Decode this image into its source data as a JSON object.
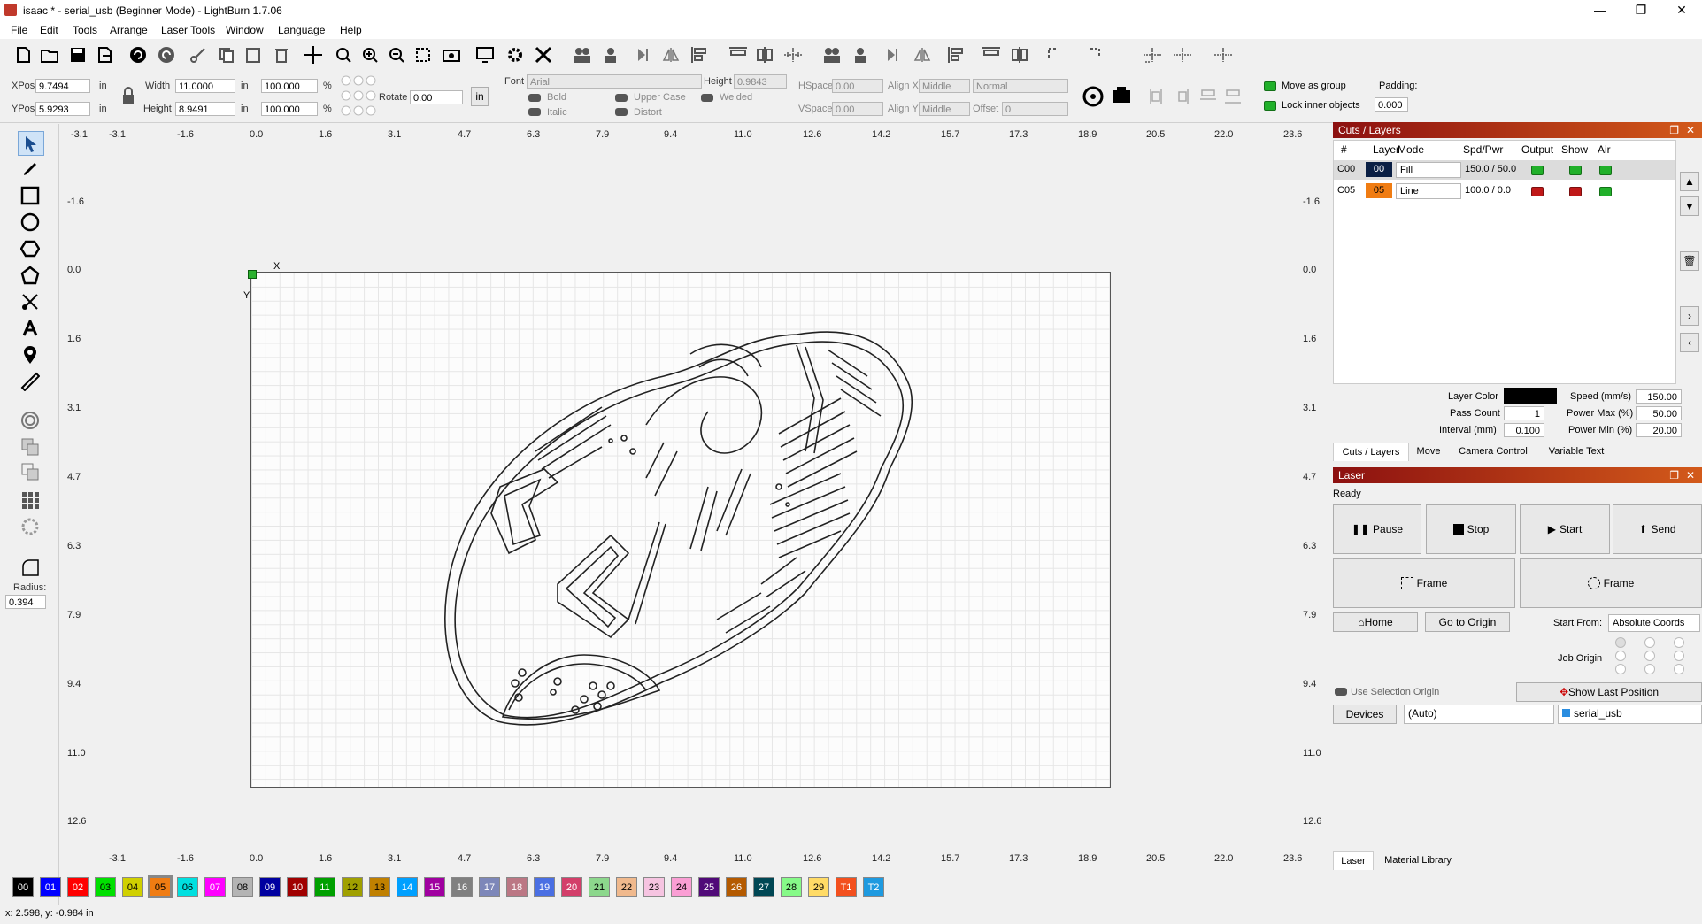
{
  "window": {
    "title": "isaac * - serial_usb (Beginner Mode) - LightBurn 1.7.06"
  },
  "menu": [
    "File",
    "Edit",
    "Tools",
    "Arrange",
    "Laser Tools",
    "Window",
    "Language",
    "Help"
  ],
  "toolbar2": {
    "xpos_label": "XPos",
    "xpos": "9.7494",
    "ypos_label": "YPos",
    "ypos": "5.9293",
    "unit": "in",
    "width_label": "Width",
    "width": "11.0000",
    "height_label": "Height",
    "height": "8.9491",
    "pct_w": "100.000",
    "pct_h": "100.000",
    "pct": "%",
    "rotate_label": "Rotate",
    "rotate": "0.00",
    "unit_btn": "in",
    "font_label": "Font",
    "font": "Arial",
    "fheight_label": "Height",
    "fheight": "0.9843",
    "bold": "Bold",
    "italic": "Italic",
    "upper": "Upper Case",
    "distort": "Distort",
    "welded": "Welded",
    "hspace_label": "HSpace",
    "hspace": "0.00",
    "vspace_label": "VSpace",
    "vspace": "0.00",
    "alignx_label": "Align X",
    "alignx": "Middle",
    "aligny_label": "Align Y",
    "aligny": "Middle",
    "normal": "Normal",
    "offset_label": "Offset",
    "offset": "0",
    "move_group": "Move as group",
    "lock_inner": "Lock inner objects",
    "padding_label": "Padding:",
    "padding": "0.000"
  },
  "left_tools": {
    "radius_label": "Radius:",
    "radius": "0.394"
  },
  "rulers": {
    "top": [
      "-3.1",
      "-3.1",
      "-1.6",
      "0.0",
      "1.6",
      "3.1",
      "4.7",
      "6.3",
      "7.9",
      "9.4",
      "11.0",
      "12.6",
      "14.2",
      "15.7",
      "17.3",
      "18.9",
      "20.5",
      "22.0",
      "23.6"
    ],
    "bottom": [
      "-3.1",
      "-1.6",
      "0.0",
      "1.6",
      "3.1",
      "4.7",
      "6.3",
      "7.9",
      "9.4",
      "11.0",
      "12.6",
      "14.2",
      "15.7",
      "17.3",
      "18.9",
      "20.5",
      "22.0",
      "23.6"
    ],
    "side": [
      "-1.6",
      "0.0",
      "1.6",
      "3.1",
      "4.7",
      "6.3",
      "7.9",
      "9.4",
      "11.0",
      "12.6"
    ],
    "axis_x": "X",
    "axis_y": "Y"
  },
  "cuts_panel": {
    "title": "Cuts / Layers",
    "headers": [
      "#",
      "Layer",
      "Mode",
      "Spd/Pwr",
      "Output",
      "Show",
      "Air"
    ],
    "rows": [
      {
        "num": "C00",
        "layer": "00",
        "color": "#0a1f44",
        "mode": "Fill",
        "spdpwr": "150.0 / 50.0",
        "output": "on",
        "show": "on",
        "air": "on"
      },
      {
        "num": "C05",
        "layer": "05",
        "color": "#f07c12",
        "mode": "Line",
        "spdpwr": "100.0 / 0.0",
        "output": "off",
        "show": "off",
        "air": "on"
      }
    ],
    "layer_color_label": "Layer Color",
    "speed_label": "Speed (mm/s)",
    "speed": "150.00",
    "pass_label": "Pass Count",
    "pass": "1",
    "pmax_label": "Power Max (%)",
    "pmax": "50.00",
    "interval_label": "Interval (mm)",
    "interval": "0.100",
    "pmin_label": "Power Min (%)",
    "pmin": "20.00",
    "tabs": [
      "Cuts / Layers",
      "Move",
      "Camera Control",
      "Variable Text"
    ]
  },
  "laser_panel": {
    "title": "Laser",
    "status": "Ready",
    "pause": "Pause",
    "stop": "Stop",
    "start": "Start",
    "send": "Send",
    "frame1": "Frame",
    "frame2": "Frame",
    "home": "Home",
    "goto_origin": "Go to Origin",
    "start_from_label": "Start From:",
    "start_from": "Absolute Coords",
    "job_origin": "Job Origin",
    "use_sel_origin": "Use Selection Origin",
    "show_last": "Show Last Position",
    "devices": "Devices",
    "auto": "(Auto)",
    "device": "serial_usb",
    "tabs": [
      "Laser",
      "Material Library"
    ]
  },
  "palette": [
    {
      "id": "00",
      "c": "#000000",
      "t": "#fff"
    },
    {
      "id": "01",
      "c": "#0000ff",
      "t": "#fff"
    },
    {
      "id": "02",
      "c": "#ff0000",
      "t": "#fff"
    },
    {
      "id": "03",
      "c": "#00e000",
      "t": "#000"
    },
    {
      "id": "04",
      "c": "#d0d000",
      "t": "#000"
    },
    {
      "id": "05",
      "c": "#f07c12",
      "t": "#000"
    },
    {
      "id": "06",
      "c": "#00e0e0",
      "t": "#000"
    },
    {
      "id": "07",
      "c": "#ff00ff",
      "t": "#fff"
    },
    {
      "id": "08",
      "c": "#b4b4b4",
      "t": "#000"
    },
    {
      "id": "09",
      "c": "#0000a0",
      "t": "#fff"
    },
    {
      "id": "10",
      "c": "#a00000",
      "t": "#fff"
    },
    {
      "id": "11",
      "c": "#00a000",
      "t": "#fff"
    },
    {
      "id": "12",
      "c": "#a0a000",
      "t": "#000"
    },
    {
      "id": "13",
      "c": "#c08000",
      "t": "#000"
    },
    {
      "id": "14",
      "c": "#00a0ff",
      "t": "#fff"
    },
    {
      "id": "15",
      "c": "#a000a0",
      "t": "#fff"
    },
    {
      "id": "16",
      "c": "#808080",
      "t": "#fff"
    },
    {
      "id": "17",
      "c": "#7d87b9",
      "t": "#fff"
    },
    {
      "id": "18",
      "c": "#bb7784",
      "t": "#fff"
    },
    {
      "id": "19",
      "c": "#4a6fe3",
      "t": "#fff"
    },
    {
      "id": "20",
      "c": "#d33f6a",
      "t": "#fff"
    },
    {
      "id": "21",
      "c": "#8cd78c",
      "t": "#000"
    },
    {
      "id": "22",
      "c": "#f0b98d",
      "t": "#000"
    },
    {
      "id": "23",
      "c": "#f6c4e1",
      "t": "#000"
    },
    {
      "id": "24",
      "c": "#fa9ed4",
      "t": "#000"
    },
    {
      "id": "25",
      "c": "#500a78",
      "t": "#fff"
    },
    {
      "id": "26",
      "c": "#b45a00",
      "t": "#fff"
    },
    {
      "id": "27",
      "c": "#004754",
      "t": "#fff"
    },
    {
      "id": "28",
      "c": "#86fa88",
      "t": "#000"
    },
    {
      "id": "29",
      "c": "#ffdb66",
      "t": "#000"
    },
    {
      "id": "T1",
      "c": "#f3501e",
      "t": "#fff"
    },
    {
      "id": "T2",
      "c": "#1e9ae0",
      "t": "#fff"
    }
  ],
  "status": {
    "coords": "x: 2.598, y: -0.984 in"
  }
}
